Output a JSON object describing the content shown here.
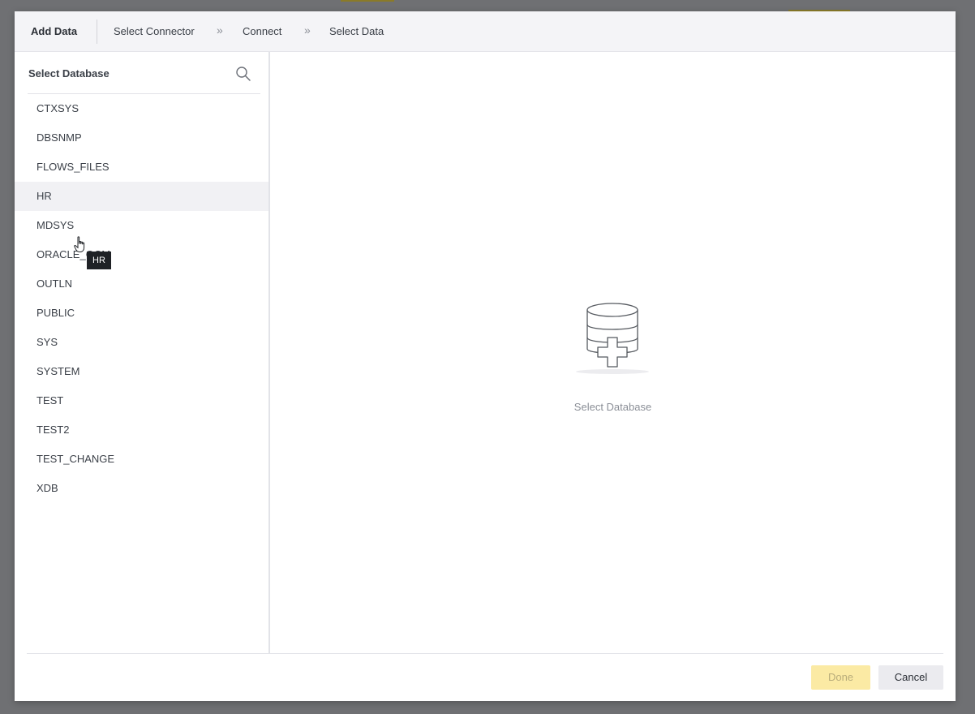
{
  "header": {
    "title": "Add Data",
    "breadcrumbs": [
      "Select Connector",
      "Connect",
      "Select Data"
    ],
    "separator": "»"
  },
  "left_panel": {
    "title": "Select Database",
    "search_icon": "search-icon",
    "items": [
      "CTXSYS",
      "DBSNMP",
      "FLOWS_FILES",
      "HR",
      "MDSYS",
      "ORACLE_OCM",
      "OUTLN",
      "PUBLIC",
      "SYS",
      "SYSTEM",
      "TEST",
      "TEST2",
      "TEST_CHANGE",
      "XDB"
    ],
    "hovered_item": "HR",
    "tooltip": "HR"
  },
  "main_panel": {
    "empty_icon": "database-add-icon",
    "empty_label": "Select Database"
  },
  "footer": {
    "done_label": "Done",
    "cancel_label": "Cancel",
    "done_disabled": true
  },
  "colors": {
    "accent_disabled": "#fbeaa4",
    "header_bg": "#f4f4f7",
    "hover_bg": "#f1f1f4"
  }
}
